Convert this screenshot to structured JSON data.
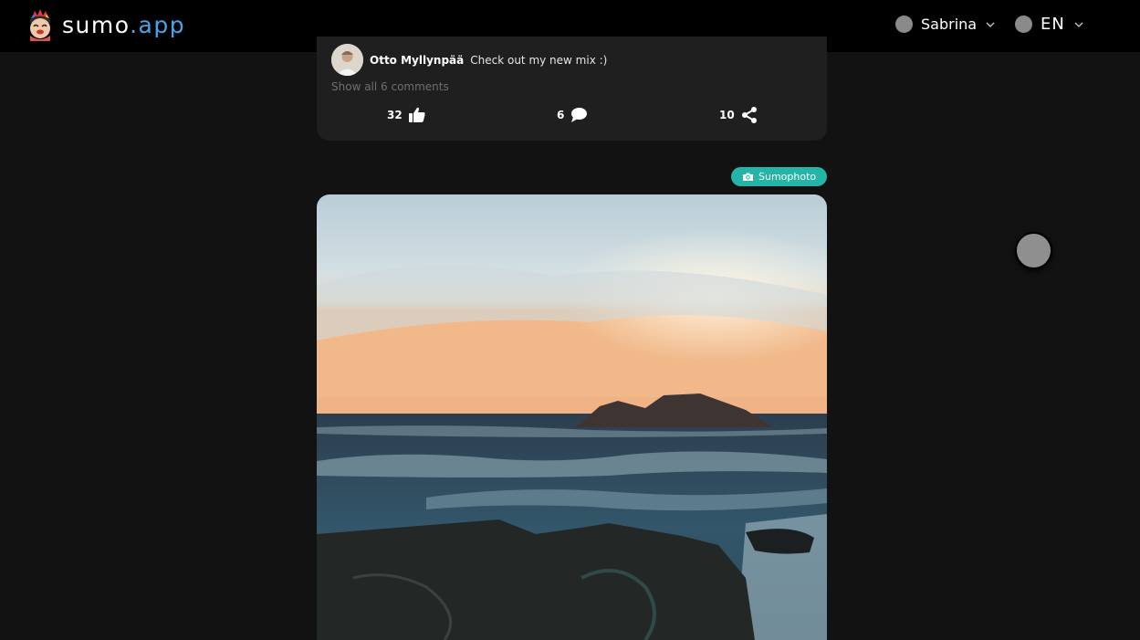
{
  "app": {
    "brand_prefix": "sumo",
    "brand_suffix": ".app"
  },
  "header": {
    "user_name": "Sabrina",
    "language": "EN"
  },
  "post": {
    "latest_comment": {
      "author": "Otto Myllynpää",
      "text": "Check out my new mix :)"
    },
    "show_comments_label": "Show all 6 comments",
    "likes": "32",
    "comments": "6",
    "shares": "10"
  },
  "next_post": {
    "badge_label": "Sumophoto",
    "badge_icon": "camera-icon"
  },
  "colors": {
    "accent": "#4aa3e8",
    "badge": "#24b5a6",
    "background": "#121212",
    "card": "#1f1f1f"
  }
}
